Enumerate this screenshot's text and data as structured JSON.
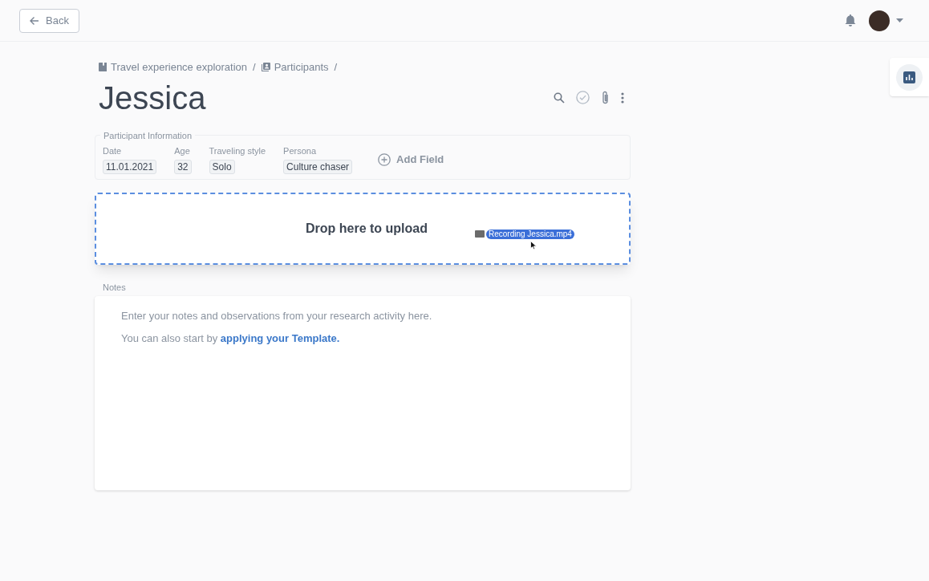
{
  "header": {
    "back_label": "Back"
  },
  "breadcrumb": [
    {
      "kind": "project",
      "label": "Travel experience exploration"
    },
    {
      "kind": "participants",
      "label": "Participants"
    }
  ],
  "breadcrumb_separator": "/",
  "title": "Jessica",
  "participant_info": {
    "legend": "Participant Information",
    "fields": [
      {
        "label": "Date",
        "value": "11.01.2021"
      },
      {
        "label": "Age",
        "value": "32"
      },
      {
        "label": "Traveling style",
        "value": "Solo"
      },
      {
        "label": "Persona",
        "value": "Culture chaser"
      }
    ],
    "add_label": "Add Field"
  },
  "dropzone": {
    "message": "Drop here to upload",
    "dragged_file": "Recording Jessica.mp4"
  },
  "notes": {
    "label": "Notes",
    "line_1": "Enter your notes and observations from your research activity here.",
    "line_2_prefix": "You can also start by",
    "line_2_link": "applying your Template."
  }
}
